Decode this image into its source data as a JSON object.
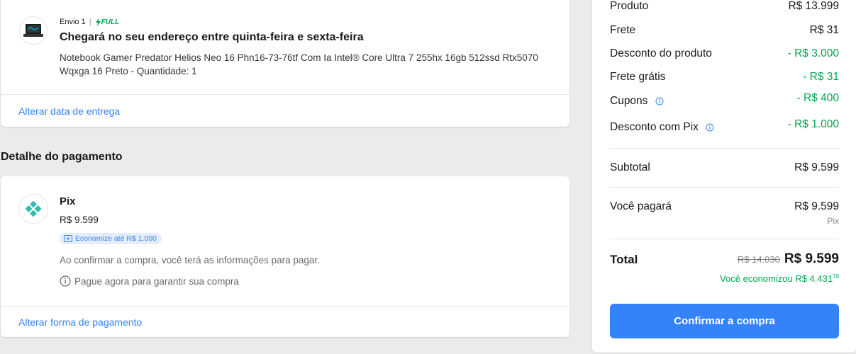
{
  "shipment": {
    "envio_label": "Envio 1",
    "separator": "|",
    "full_label": "FULL",
    "title": "Chegará no seu endereço entre quinta-feira e sexta-feira",
    "description": "Notebook Gamer Predator Helios Neo 16 Phn16-73-76tf Com Ia Intel® Core Ultra 7 255hx 16gb 512ssd Rtx5070 Wqxga 16 Preto - Quantidade: 1",
    "change_date_link": "Alterar data de entrega",
    "thumbnail_icon": "laptop-icon"
  },
  "payment_section": {
    "title": "Detalhe do pagamento",
    "method": "Pix",
    "method_icon": "pix-icon",
    "amount": "R$ 9.599",
    "badge": "Economize até R$ 1.000",
    "info": "Ao confirmar a compra, você terá as informações para pagar.",
    "note": "Pague agora para garantir sua compra",
    "change_method_link": "Alterar forma de pagamento"
  },
  "summary": {
    "rows": [
      {
        "label": "Produto",
        "value": "R$ 13.999"
      },
      {
        "label": "Frete",
        "value": "R$ 31"
      },
      {
        "label": "Desconto do produto",
        "value": "- R$ 3.000"
      },
      {
        "label": "Frete grátis",
        "value": "- R$ 31"
      },
      {
        "label": "Cupons",
        "value": "- R$ 400"
      },
      {
        "label": "Desconto com Pix",
        "value": "- R$ 1.000"
      }
    ],
    "subtotal_label": "Subtotal",
    "subtotal_value": "R$ 9.599",
    "pay_label": "Você pagará",
    "pay_value": "R$ 9.599",
    "pay_method": "Pix",
    "total_label": "Total",
    "total_old": "R$ 14.030",
    "total_new": "R$ 9.599",
    "saved_text": "Você economizou R$ 4.431",
    "saved_cents": "70",
    "confirm_button": "Confirmar a compra"
  },
  "colors": {
    "accent": "#3483fa",
    "green": "#00a650",
    "pix": "#32bcad"
  }
}
